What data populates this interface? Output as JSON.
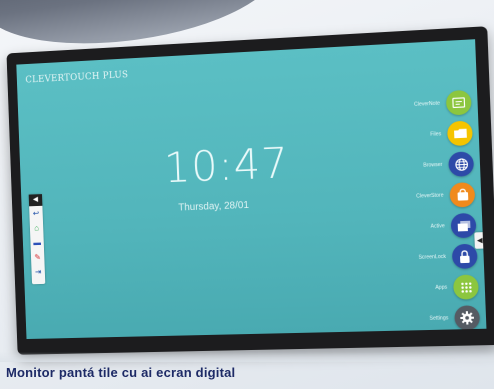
{
  "screen": {
    "brand": "CLEVERTOUCH PLUS",
    "time": "10:47",
    "date": "Thursday, 28/01"
  },
  "toolbar": {
    "collapse_glyph": "◀",
    "items": [
      {
        "name": "undo-icon",
        "glyph": "↩",
        "color": "#1e4fa8"
      },
      {
        "name": "home-icon",
        "glyph": "⌂",
        "color": "#2aa84a"
      },
      {
        "name": "whiteboard-icon",
        "glyph": "▬",
        "color": "#2a4fb8"
      },
      {
        "name": "pen-icon",
        "glyph": "✎",
        "color": "#d3262b"
      },
      {
        "name": "source-icon",
        "glyph": "⇥",
        "color": "#1e4fa8"
      }
    ]
  },
  "right_handle": {
    "glyph": "◀"
  },
  "apps": [
    {
      "label": "CleverNote",
      "icon": "note-icon",
      "color": "#8cc63f"
    },
    {
      "label": "Files",
      "icon": "folder-icon",
      "color": "#f5c400"
    },
    {
      "label": "Browser",
      "icon": "globe-icon",
      "color": "#2d4aa8"
    },
    {
      "label": "CleverStore",
      "icon": "store-bag-icon",
      "color": "#f08a1c"
    },
    {
      "label": "Active",
      "icon": "windows-icon",
      "color": "#2d4aa8"
    },
    {
      "label": "ScreenLock",
      "icon": "lock-icon",
      "color": "#2d4aa8"
    },
    {
      "label": "Apps",
      "icon": "apps-grid-icon",
      "color": "#8cc63f"
    },
    {
      "label": "Settings",
      "icon": "gear-icon",
      "color": "#555b63"
    }
  ],
  "caption": "Monitor pantá tile cu ai ecran digital"
}
